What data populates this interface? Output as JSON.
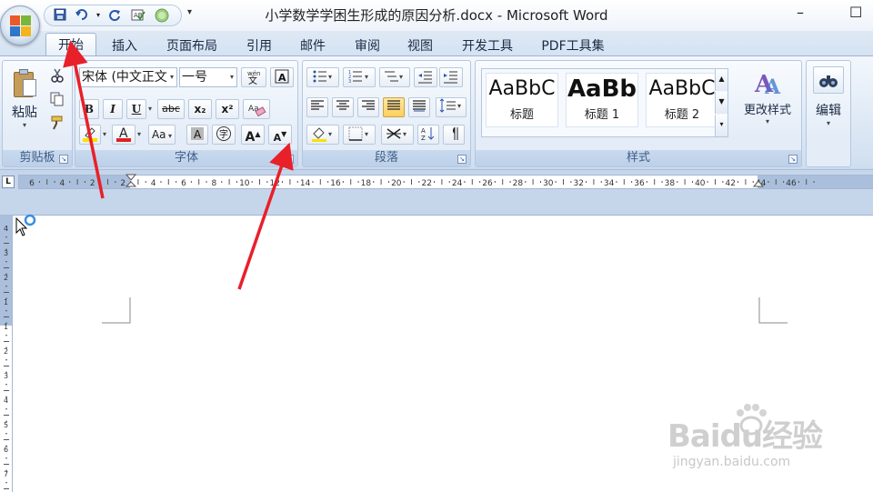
{
  "window": {
    "title": "小学数学学困生形成的原因分析.docx - Microsoft Word",
    "minimize": "–",
    "maximize": "☐"
  },
  "qat": {
    "dropdown": "▾"
  },
  "tabs": [
    "开始",
    "插入",
    "页面布局",
    "引用",
    "邮件",
    "审阅",
    "视图",
    "开发工具",
    "PDF工具集"
  ],
  "clipboard": {
    "paste_label": "粘贴",
    "group_label": "剪贴板"
  },
  "font": {
    "font_name": "宋体 (中文正文",
    "font_size": "一号",
    "group_label": "字体",
    "bold": "B",
    "italic": "I",
    "underline": "U",
    "strike": "abc",
    "subscript": "x₂",
    "superscript": "x²",
    "case": "Aa",
    "grow": "A",
    "shrink": "A"
  },
  "paragraph": {
    "group_label": "段落"
  },
  "styles": {
    "group_label": "样式",
    "items": [
      {
        "sample": "AaBbC",
        "name": "标题"
      },
      {
        "sample": "AaBb",
        "name": "标题 1"
      },
      {
        "sample": "AaBbC",
        "name": "标题 2"
      }
    ],
    "change_styles": "更改样式"
  },
  "editing": {
    "label": "编辑"
  },
  "ruler": {
    "corner": "L",
    "labels": [
      "6",
      "4",
      "2",
      "2",
      "4",
      "6",
      "8",
      "10",
      "12",
      "14",
      "16",
      "18",
      "20",
      "22",
      "24",
      "26",
      "28",
      "30",
      "32",
      "34",
      "36",
      "38",
      "40",
      "42",
      "44",
      "46"
    ],
    "vlabels": [
      "4",
      "3",
      "2",
      "1",
      "1",
      "2",
      "3",
      "4",
      "5",
      "6",
      "7"
    ]
  },
  "watermark": {
    "brand": "Baidu经验",
    "url": "jingyan.baidu.com"
  },
  "colors": {
    "accent": "#3e5c86",
    "arrow": "#e8202a",
    "font_color_bar": "#e02020",
    "highlight_bar": "#f7e300"
  }
}
